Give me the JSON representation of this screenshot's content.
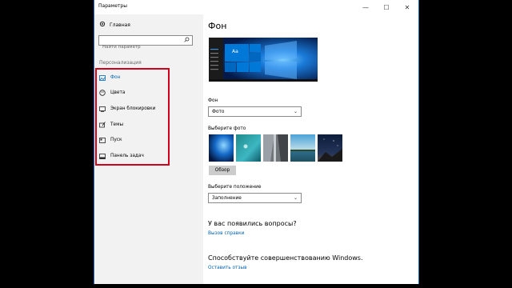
{
  "window": {
    "title": "Параметры",
    "minimize_glyph": "—",
    "maximize_glyph": "☐",
    "close_glyph": "✕"
  },
  "sidebar": {
    "home_label": "Главная",
    "search": {
      "placeholder": "Найти параметр"
    },
    "section_title": "Персонализация",
    "items": [
      {
        "label": "Фон",
        "icon": "picture-icon",
        "active": true
      },
      {
        "label": "Цвета",
        "icon": "palette-icon",
        "active": false
      },
      {
        "label": "Экран блокировки",
        "icon": "lock-screen-icon",
        "active": false
      },
      {
        "label": "Темы",
        "icon": "brush-icon",
        "active": false
      },
      {
        "label": "Пуск",
        "icon": "start-icon",
        "active": false
      },
      {
        "label": "Панель задач",
        "icon": "taskbar-icon",
        "active": false
      }
    ]
  },
  "main": {
    "title": "Фон",
    "preview_tile_text": "Aa",
    "background": {
      "label": "Фон",
      "value": "Фото"
    },
    "choose_photo": {
      "label": "Выберите фото",
      "browse_label": "Обзор"
    },
    "position": {
      "label": "Выберите положение",
      "value": "Заполнение"
    },
    "questions": {
      "title": "У вас появились вопросы?",
      "link": "Вызов справки"
    },
    "improve": {
      "title": "Способствуйте совершенствованию Windows.",
      "link": "Оставить отзыв"
    }
  },
  "colors": {
    "accent": "#0063b1",
    "highlight_box": "#d0021b",
    "window_border": "#1f6fbf"
  }
}
